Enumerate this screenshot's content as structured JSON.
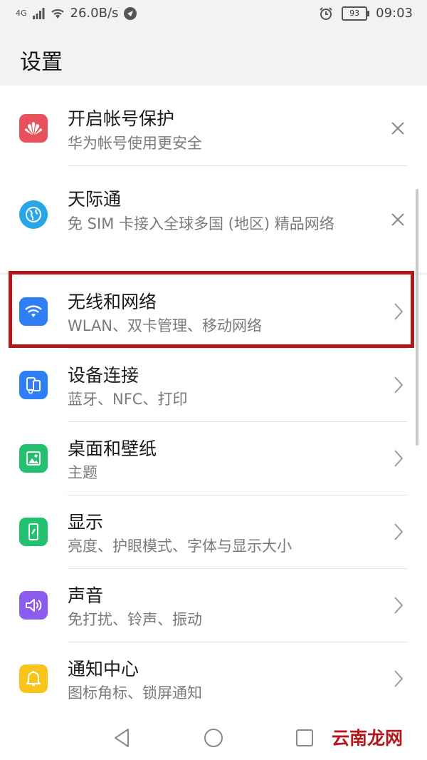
{
  "status_bar": {
    "network": "4G",
    "speed": "26.0B/s",
    "battery": "93",
    "time": "09:03"
  },
  "header": {
    "title": "设置"
  },
  "suggestions": [
    {
      "title": "开启帐号保护",
      "subtitle": "华为帐号使用更安全",
      "icon": "huawei-logo-icon",
      "color": "#e8505b"
    },
    {
      "title": "天际通",
      "subtitle": "免 SIM 卡接入全球多国 (地区) 精品网络",
      "icon": "globe-icon",
      "color": "#27a6e8"
    }
  ],
  "settings": [
    {
      "title": "无线和网络",
      "subtitle": "WLAN、双卡管理、移动网络",
      "icon": "wifi-icon",
      "color": "#2f7ef5"
    },
    {
      "title": "设备连接",
      "subtitle": "蓝牙、NFC、打印",
      "icon": "device-connect-icon",
      "color": "#2f7ef5"
    },
    {
      "title": "桌面和壁纸",
      "subtitle": "主题",
      "icon": "wallpaper-icon",
      "color": "#23c06f"
    },
    {
      "title": "显示",
      "subtitle": "亮度、护眼模式、字体与显示大小",
      "icon": "display-icon",
      "color": "#23c06f"
    },
    {
      "title": "声音",
      "subtitle": "免打扰、铃声、振动",
      "icon": "sound-icon",
      "color": "#8b5cf0"
    },
    {
      "title": "通知中心",
      "subtitle": "图标角标、锁屏通知",
      "icon": "bell-icon",
      "color": "#f7c51b"
    }
  ],
  "watermark": {
    "text": "云南龙网"
  }
}
